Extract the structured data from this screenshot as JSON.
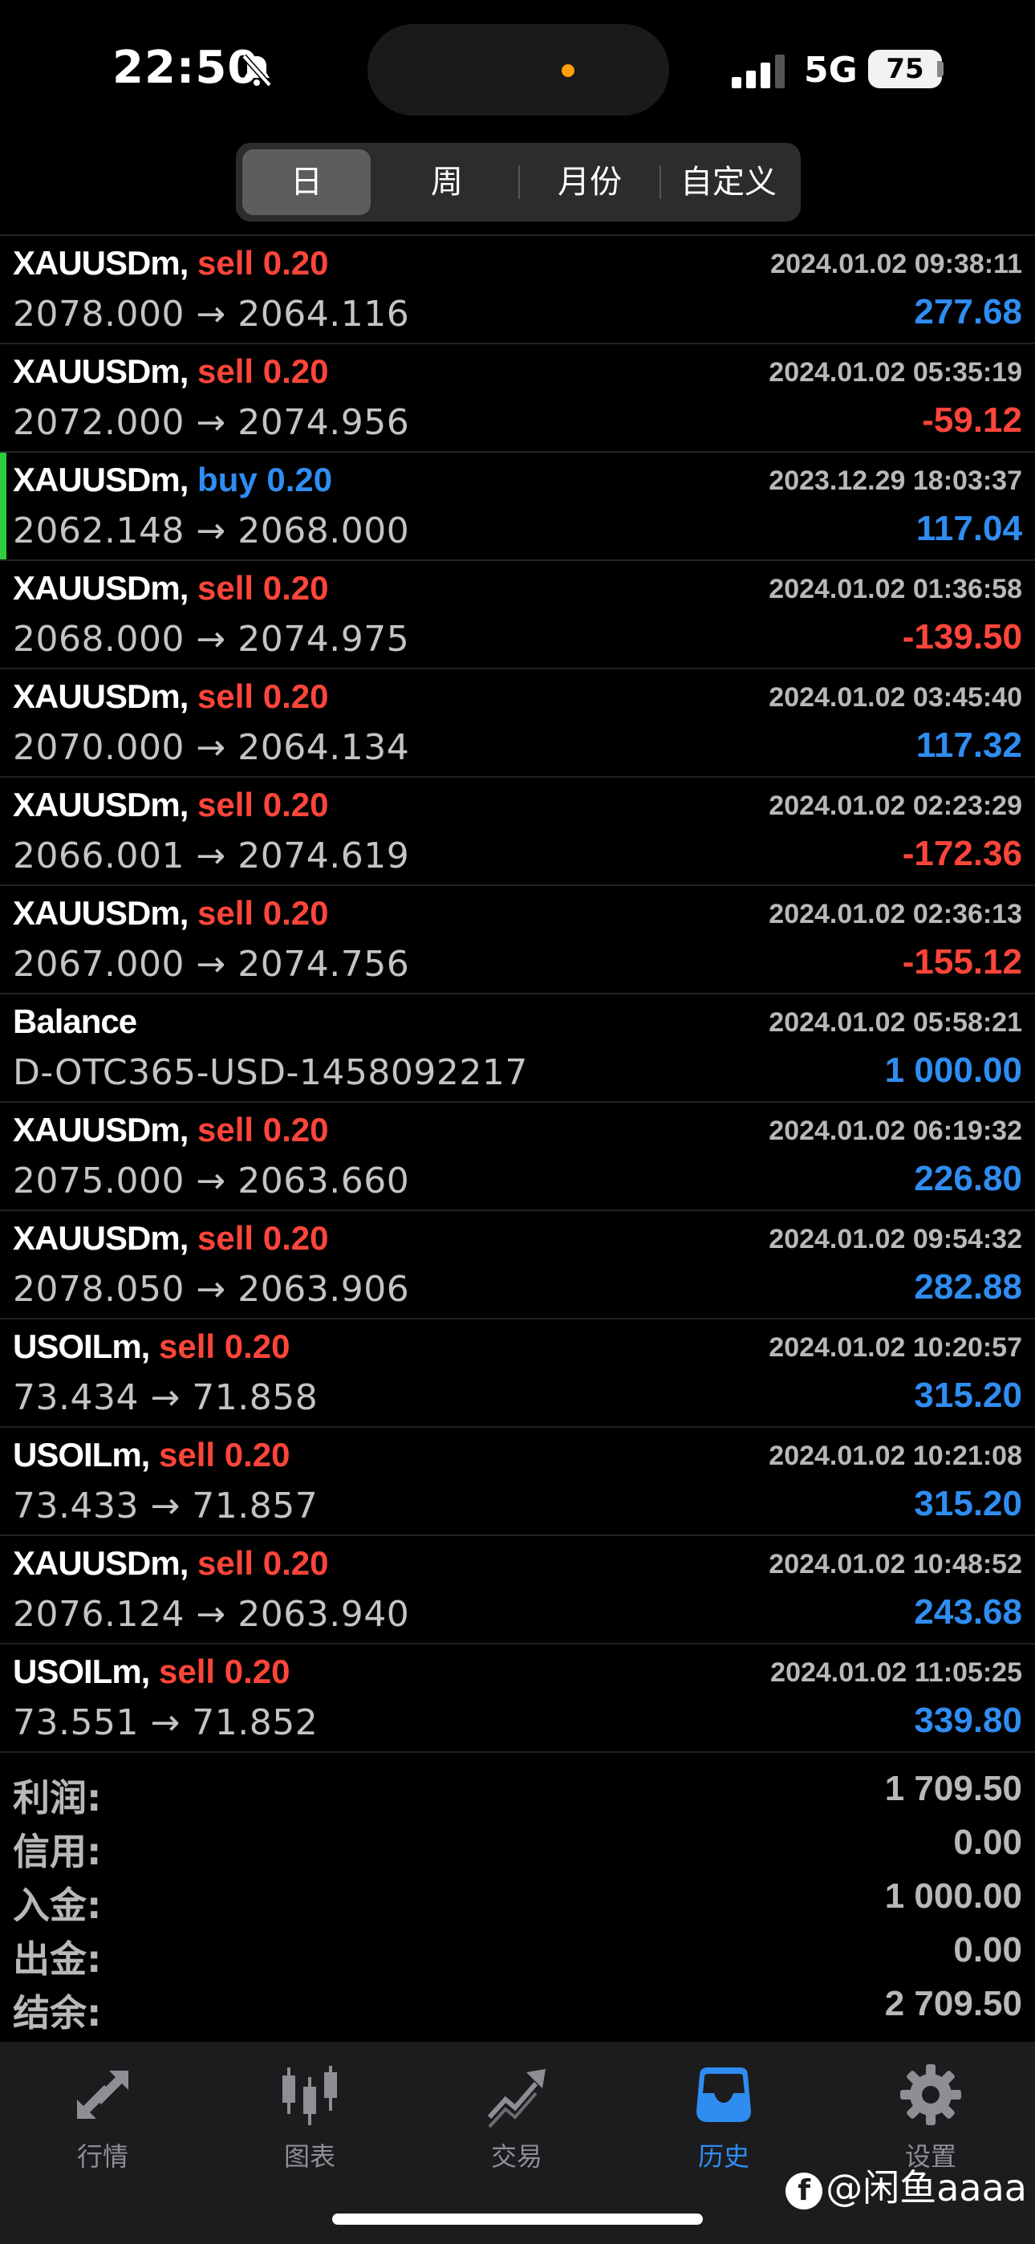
{
  "status_bar": {
    "time": "22:50",
    "network": "5G",
    "battery": "75"
  },
  "period_tabs": [
    {
      "label": "日",
      "active": true
    },
    {
      "label": "周",
      "active": false
    },
    {
      "label": "月份",
      "active": false
    },
    {
      "label": "自定义",
      "active": false
    }
  ],
  "history": [
    {
      "symbol": "XAUUSDm,",
      "side": "sell 0.20",
      "side_type": "sell",
      "date": "2024.01.02 09:38:11",
      "prices": "2078.000 → 2064.116",
      "profit": "277.68",
      "profit_sign": "pos"
    },
    {
      "symbol": "XAUUSDm,",
      "side": "sell 0.20",
      "side_type": "sell",
      "date": "2024.01.02 05:35:19",
      "prices": "2072.000 → 2074.956",
      "profit": "-59.12",
      "profit_sign": "neg"
    },
    {
      "symbol": "XAUUSDm,",
      "side": "buy 0.20",
      "side_type": "buy",
      "date": "2023.12.29 18:03:37",
      "prices": "2062.148 → 2068.000",
      "profit": "117.04",
      "profit_sign": "pos",
      "highlight": true
    },
    {
      "symbol": "XAUUSDm,",
      "side": "sell 0.20",
      "side_type": "sell",
      "date": "2024.01.02 01:36:58",
      "prices": "2068.000 → 2074.975",
      "profit": "-139.50",
      "profit_sign": "neg"
    },
    {
      "symbol": "XAUUSDm,",
      "side": "sell 0.20",
      "side_type": "sell",
      "date": "2024.01.02 03:45:40",
      "prices": "2070.000 → 2064.134",
      "profit": "117.32",
      "profit_sign": "pos"
    },
    {
      "symbol": "XAUUSDm,",
      "side": "sell 0.20",
      "side_type": "sell",
      "date": "2024.01.02 02:23:29",
      "prices": "2066.001 → 2074.619",
      "profit": "-172.36",
      "profit_sign": "neg"
    },
    {
      "symbol": "XAUUSDm,",
      "side": "sell 0.20",
      "side_type": "sell",
      "date": "2024.01.02 02:36:13",
      "prices": "2067.000 → 2074.756",
      "profit": "-155.12",
      "profit_sign": "neg"
    },
    {
      "symbol": "Balance",
      "side": "",
      "side_type": "none",
      "date": "2024.01.02 05:58:21",
      "prices": "D-OTC365-USD-1458092217",
      "profit": "1 000.00",
      "profit_sign": "pos"
    },
    {
      "symbol": "XAUUSDm,",
      "side": "sell 0.20",
      "side_type": "sell",
      "date": "2024.01.02 06:19:32",
      "prices": "2075.000 → 2063.660",
      "profit": "226.80",
      "profit_sign": "pos"
    },
    {
      "symbol": "XAUUSDm,",
      "side": "sell 0.20",
      "side_type": "sell",
      "date": "2024.01.02 09:54:32",
      "prices": "2078.050 → 2063.906",
      "profit": "282.88",
      "profit_sign": "pos"
    },
    {
      "symbol": "USOILm,",
      "side": "sell 0.20",
      "side_type": "sell",
      "date": "2024.01.02 10:20:57",
      "prices": "73.434 → 71.858",
      "profit": "315.20",
      "profit_sign": "pos"
    },
    {
      "symbol": "USOILm,",
      "side": "sell 0.20",
      "side_type": "sell",
      "date": "2024.01.02 10:21:08",
      "prices": "73.433 → 71.857",
      "profit": "315.20",
      "profit_sign": "pos"
    },
    {
      "symbol": "XAUUSDm,",
      "side": "sell 0.20",
      "side_type": "sell",
      "date": "2024.01.02 10:48:52",
      "prices": "2076.124 → 2063.940",
      "profit": "243.68",
      "profit_sign": "pos"
    },
    {
      "symbol": "USOILm,",
      "side": "sell 0.20",
      "side_type": "sell",
      "date": "2024.01.02 11:05:25",
      "prices": "73.551 → 71.852",
      "profit": "339.80",
      "profit_sign": "pos"
    }
  ],
  "summary": [
    {
      "label": "利润:",
      "value": "1 709.50"
    },
    {
      "label": "信用:",
      "value": "0.00"
    },
    {
      "label": "入金:",
      "value": "1 000.00"
    },
    {
      "label": "出金:",
      "value": "0.00"
    },
    {
      "label": "结余:",
      "value": "2 709.50"
    }
  ],
  "tabbar": [
    {
      "label": "行情",
      "icon": "quotes-arrows-icon",
      "active": false
    },
    {
      "label": "图表",
      "icon": "candlestick-chart-icon",
      "active": false
    },
    {
      "label": "交易",
      "icon": "trade-chart-icon",
      "active": false
    },
    {
      "label": "历史",
      "icon": "history-inbox-icon",
      "active": true
    },
    {
      "label": "设置",
      "icon": "gear-icon",
      "active": false
    }
  ],
  "watermark": {
    "logo": "f",
    "text": "@闲鱼aaaa"
  },
  "colors": {
    "sell": "#ff453a",
    "buy": "#2f8df2",
    "profit_positive": "#2f8df2",
    "profit_negative": "#ff453a",
    "active_tab": "#2f8df2",
    "highlight_bar": "#2ecc40"
  }
}
